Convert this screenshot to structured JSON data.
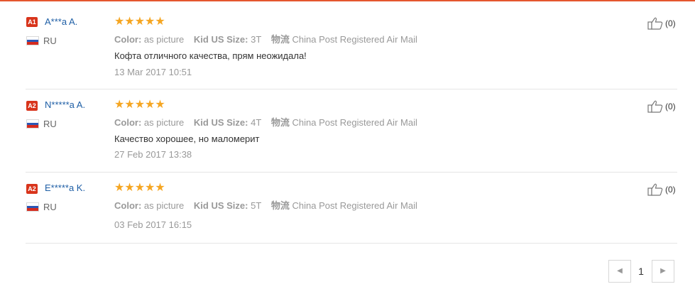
{
  "reviews": [
    {
      "badge": "A1",
      "name": "A***a A.",
      "country": "RU",
      "stars": "★★★★★",
      "color_label": "Color:",
      "color_value": "as picture",
      "size_label": "Kid US Size:",
      "size_value": "3T",
      "shipping_label": "物流",
      "shipping_value": "China Post Registered Air Mail",
      "text": "Кофта отличного качества, прям неожидала!",
      "date": "13 Mar 2017 10:51",
      "likes": "(0)"
    },
    {
      "badge": "A2",
      "name": "N*****a A.",
      "country": "RU",
      "stars": "★★★★★",
      "color_label": "Color:",
      "color_value": "as picture",
      "size_label": "Kid US Size:",
      "size_value": "4T",
      "shipping_label": "物流",
      "shipping_value": "China Post Registered Air Mail",
      "text": "Качество хорошее, но маломерит",
      "date": "27 Feb 2017 13:38",
      "likes": "(0)"
    },
    {
      "badge": "A2",
      "name": "E*****a K.",
      "country": "RU",
      "stars": "★★★★★",
      "color_label": "Color:",
      "color_value": "as picture",
      "size_label": "Kid US Size:",
      "size_value": "5T",
      "shipping_label": "物流",
      "shipping_value": "China Post Registered Air Mail",
      "text": "",
      "date": "03 Feb 2017 16:15",
      "likes": "(0)"
    }
  ],
  "pager": {
    "prev_icon": "◀",
    "page": "1",
    "next_icon": "▶"
  },
  "colors": {
    "accent": "#e4562e",
    "link": "#1f5fa6",
    "star": "#f5a623",
    "badge": "#d8341b"
  },
  "icons": {
    "flag": "russia-flag-icon",
    "like": "thumbs-up-icon"
  }
}
